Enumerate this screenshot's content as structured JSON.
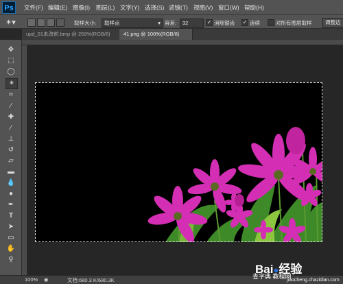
{
  "app": {
    "logo_text": "Ps"
  },
  "menu": [
    "文件(F)",
    "编辑(E)",
    "图像(I)",
    "图层(L)",
    "文字(Y)",
    "选择(S)",
    "滤镜(T)",
    "视图(V)",
    "窗口(W)",
    "帮助(H)"
  ],
  "options": {
    "sample_size_label": "取样大小:",
    "sample_size_value": "取样点",
    "tolerance_label": "容差:",
    "tolerance_value": "32",
    "antialias_label": "消除锯齿",
    "contiguous_label": "连续",
    "all_layers_label": "对所有图层取样",
    "refine_edge_label": "调整边"
  },
  "tabs": [
    {
      "label": "upd_01未改前.bmp @ 259%(RGB/8)",
      "active": false
    },
    {
      "label": "41.png @ 100%(RGB/8)",
      "active": true
    }
  ],
  "status": {
    "zoom": "100%",
    "doc_info": "文档:680.3 K/680.3K"
  },
  "watermark": {
    "brand": "Bai",
    "brand2": "经验",
    "site_cn": "查字典 教程网",
    "url": "jiaocheng.chazidian.com"
  },
  "colors": {
    "accent": "#31a8ff",
    "flower": "#d42fb4",
    "leaf": "#4a8a2a"
  }
}
